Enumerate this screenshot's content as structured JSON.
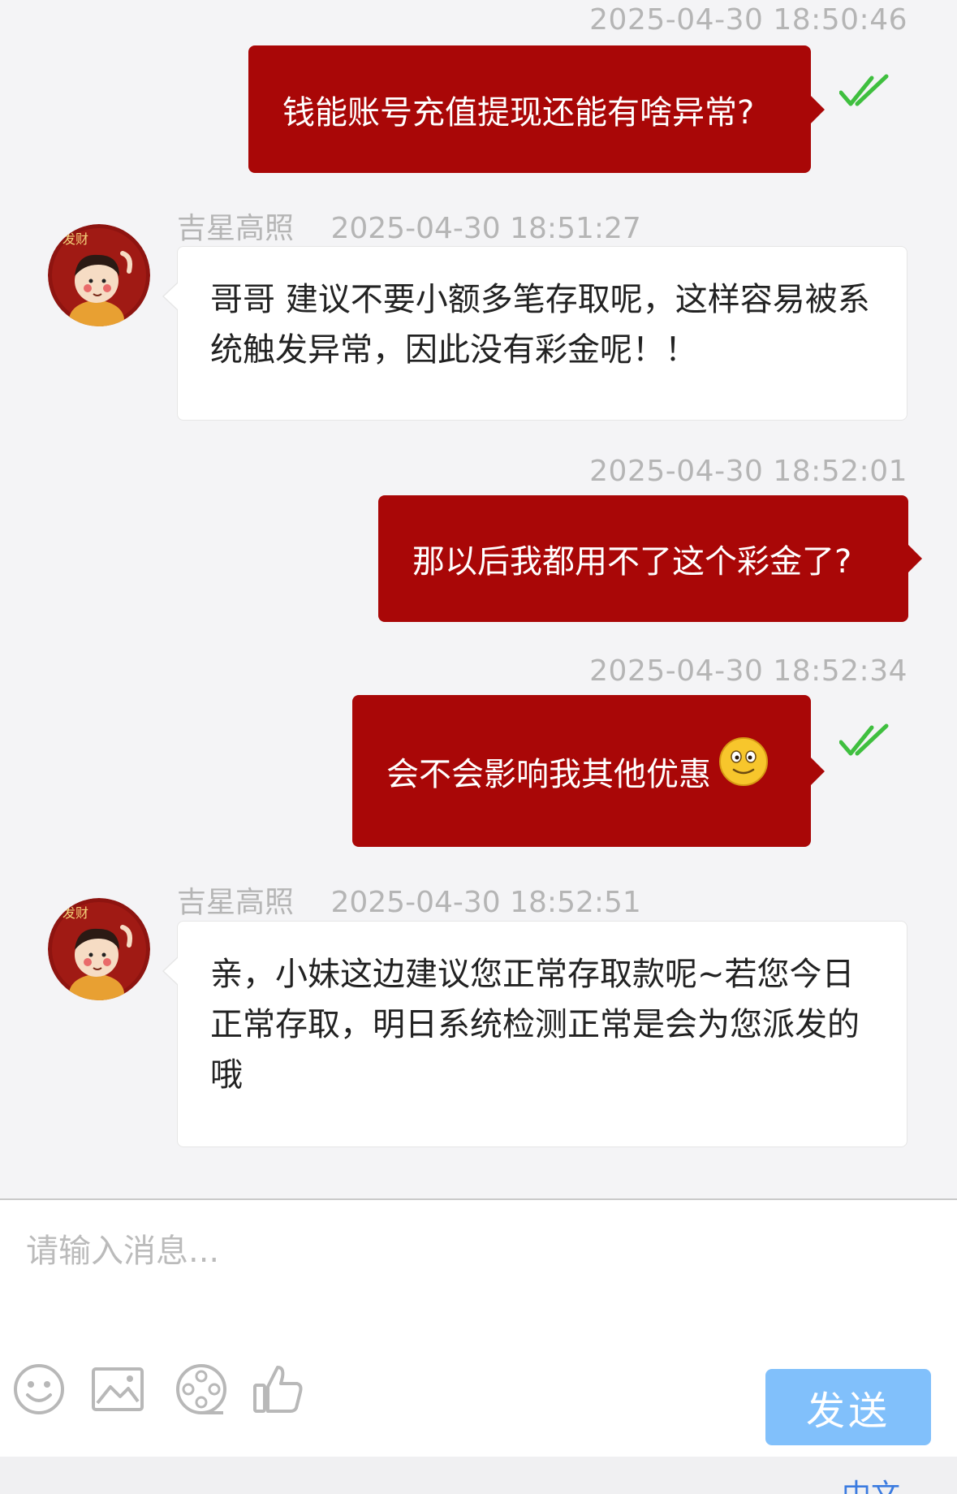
{
  "chat": {
    "messages": [
      {
        "type": "outgoing",
        "time": "2025-04-30 18:50:46",
        "text": "钱能账号充值提现还能有啥异常?",
        "read": true
      },
      {
        "type": "incoming",
        "nickname": "吉星高照",
        "time": "2025-04-30 18:51:27",
        "text": "哥哥 建议不要小额多笔存取呢，这样容易被系统触发异常，因此没有彩金呢！！"
      },
      {
        "type": "outgoing",
        "time": "2025-04-30 18:52:01",
        "text": "那以后我都用不了这个彩金了?",
        "read": false
      },
      {
        "type": "outgoing",
        "time": "2025-04-30 18:52:34",
        "text": "会不会影响我其他优惠",
        "emoji": "smiley-emoji",
        "read": true
      },
      {
        "type": "incoming",
        "nickname": "吉星高照",
        "time": "2025-04-30 18:52:51",
        "text": "亲，小妹这边建议您正常存取款呢~若您今日正常存取，明日系统检测正常是会为您派发的哦"
      }
    ],
    "avatar_badge": "发财",
    "colors": {
      "outgoing_bubble": "#a90707",
      "read_check": "#3fbf3f",
      "send_button": "#81c0fb"
    }
  },
  "composer": {
    "placeholder": "请输入消息...",
    "tools": [
      "emoji-icon",
      "image-icon",
      "film-reel-icon",
      "thumbs-up-icon"
    ],
    "send_label": "发送"
  },
  "footer": {
    "language": "中文"
  }
}
